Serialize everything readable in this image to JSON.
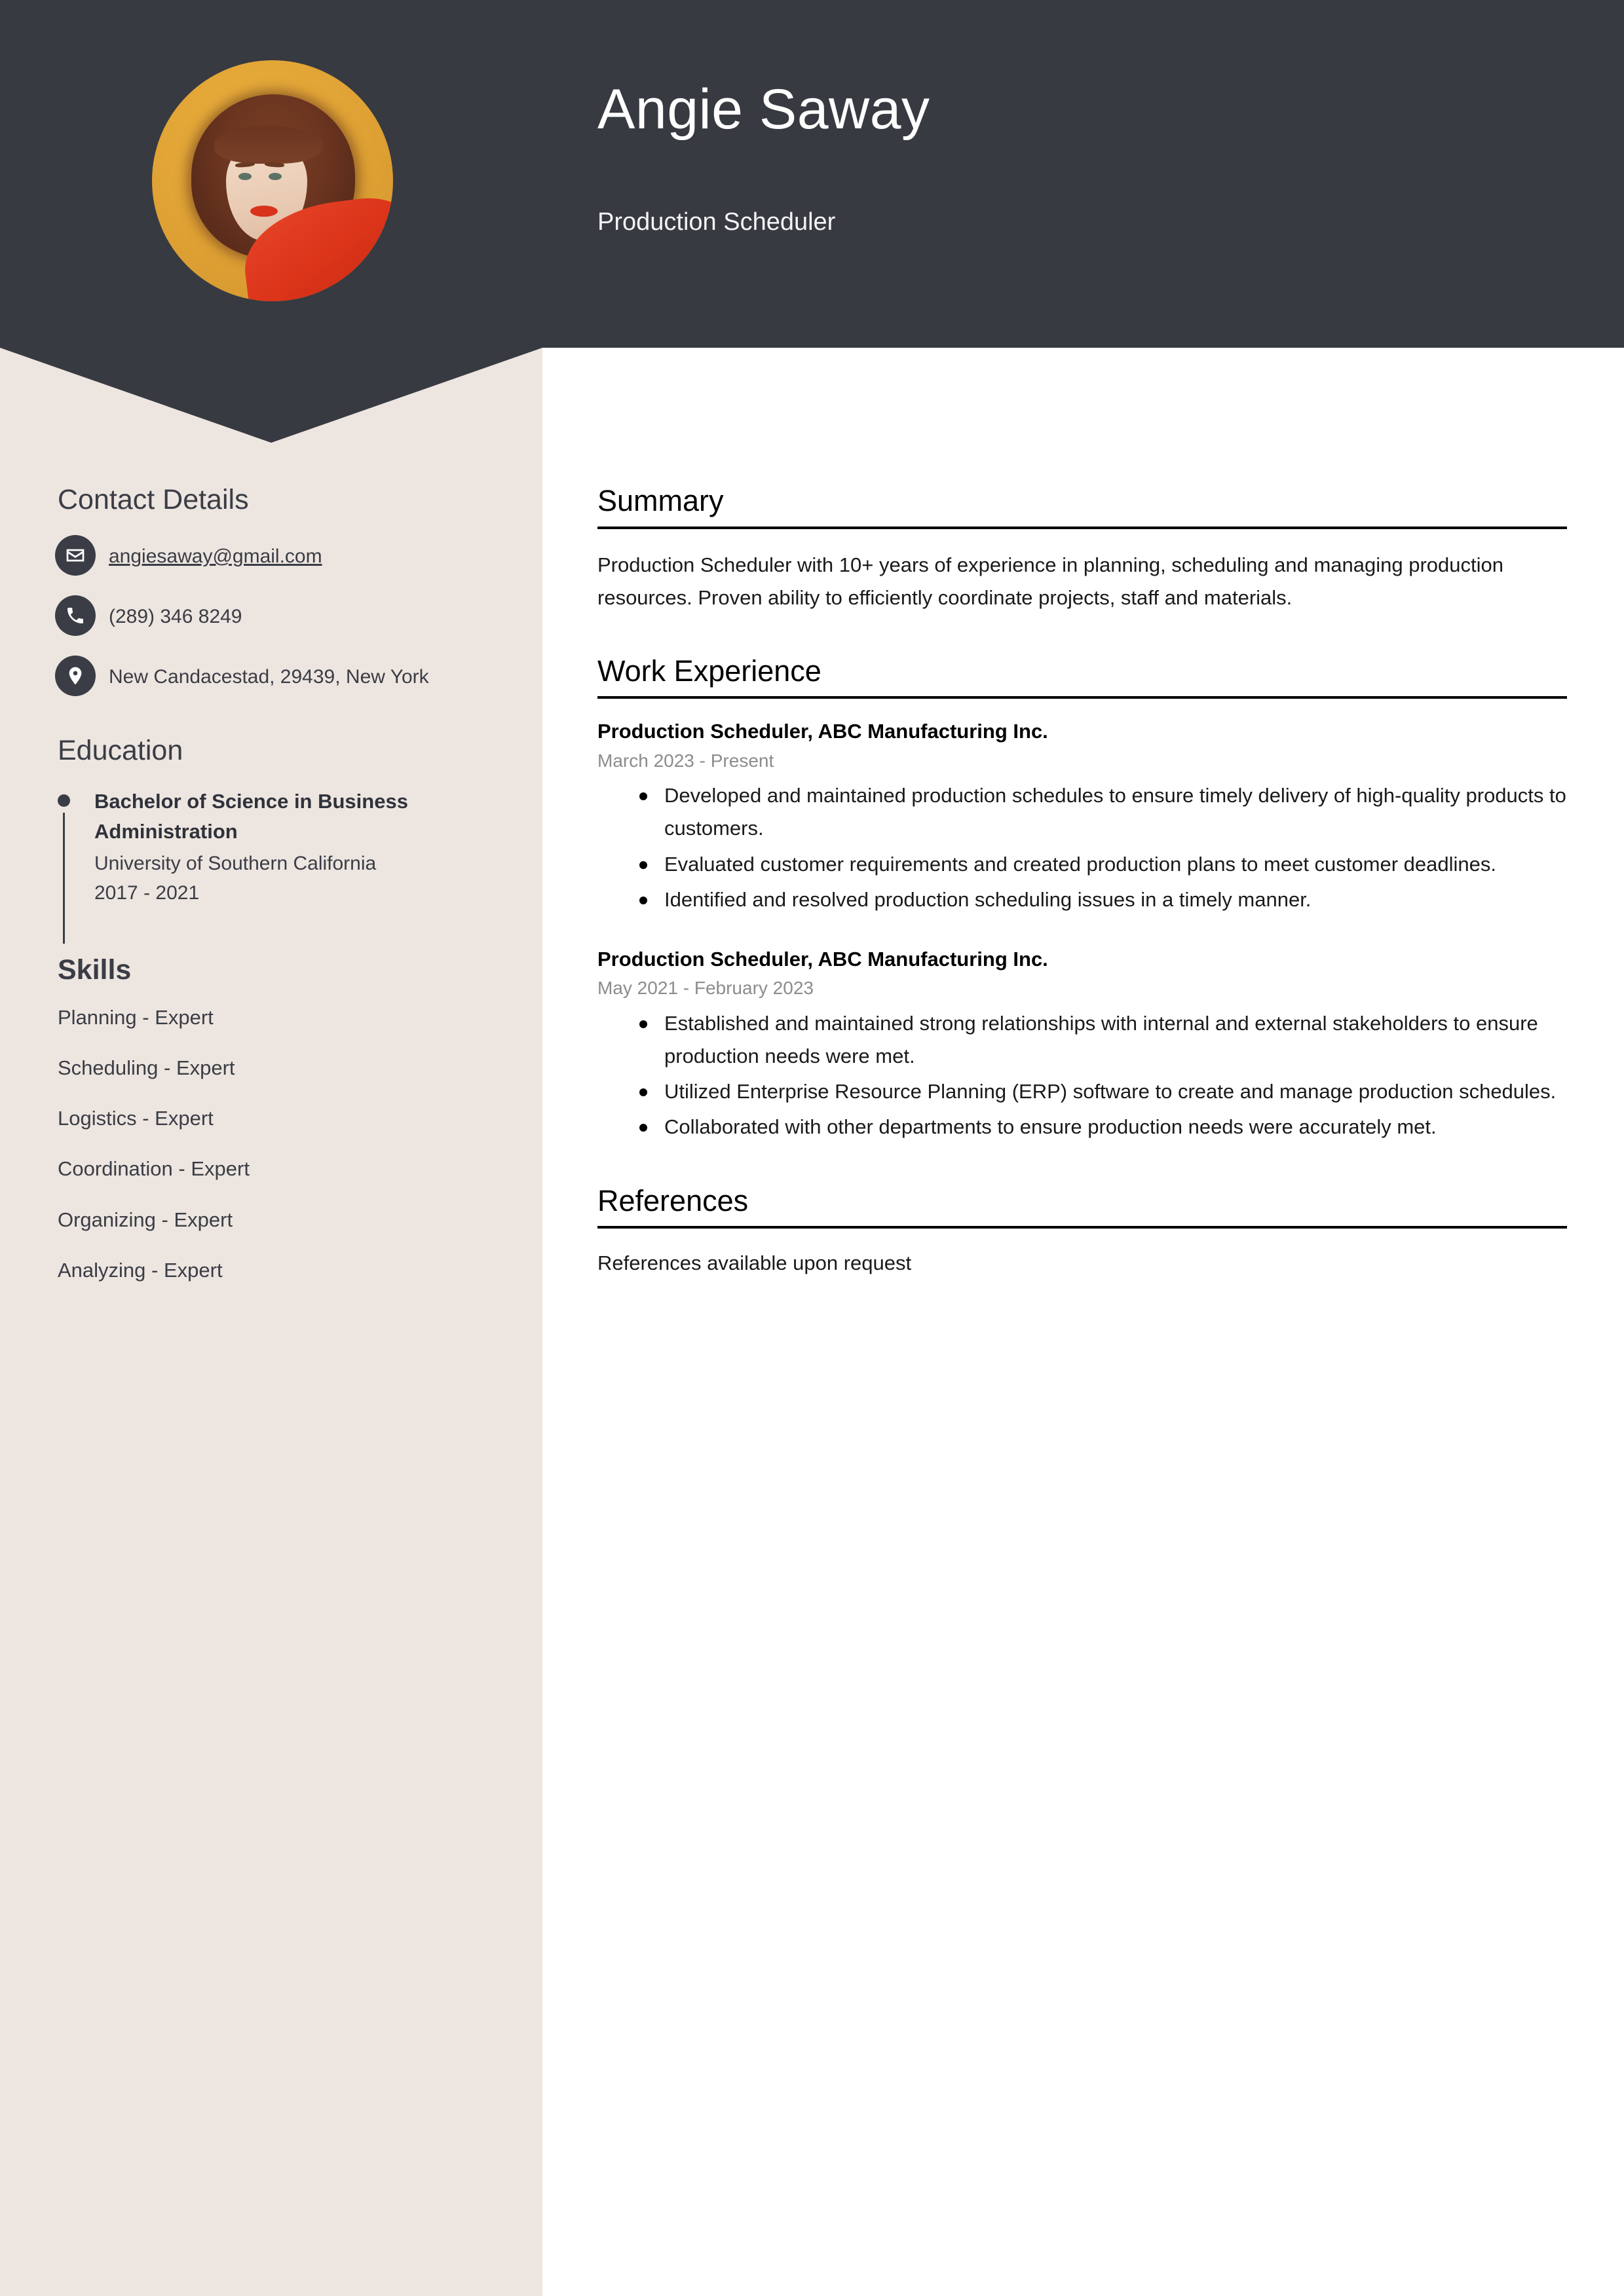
{
  "header": {
    "name": "Angie Saway",
    "job_title": "Production Scheduler",
    "colors": {
      "background": "#373A40",
      "text": "#FFFFFF"
    },
    "avatar_alt": "profile-photo"
  },
  "sidebar": {
    "background_color": "#EDE5E0",
    "contact": {
      "heading": "Contact Details",
      "items": [
        {
          "icon": "envelope-icon",
          "value": "angiesaway@gmail.com",
          "is_link": true
        },
        {
          "icon": "phone-icon",
          "value": "(289) 346 8249",
          "is_link": false
        },
        {
          "icon": "location-pin-icon",
          "value": "New Candacestad, 29439, New York",
          "is_link": false
        }
      ]
    },
    "education": {
      "heading": "Education",
      "items": [
        {
          "degree": "Bachelor of Science in Business Administration",
          "school": "University of Southern California",
          "dates": "2017 - 2021"
        }
      ]
    },
    "skills": {
      "heading": "Skills",
      "items": [
        "Planning - Expert",
        "Scheduling - Expert",
        "Logistics - Expert",
        "Coordination - Expert",
        "Organizing - Expert",
        "Analyzing - Expert"
      ]
    }
  },
  "main": {
    "summary": {
      "heading": "Summary",
      "text": "Production Scheduler with 10+ years of experience in planning, scheduling and managing production resources. Proven ability to efficiently coordinate projects, staff and materials."
    },
    "work_experience": {
      "heading": "Work Experience",
      "jobs": [
        {
          "title": "Production Scheduler, ABC Manufacturing Inc.",
          "dates": "March 2023 - Present",
          "bullets": [
            "Developed and maintained production schedules to ensure timely delivery of high-quality products to customers.",
            "Evaluated customer requirements and created production plans to meet customer deadlines.",
            "Identified and resolved production scheduling issues in a timely manner."
          ]
        },
        {
          "title": "Production Scheduler, ABC Manufacturing Inc.",
          "dates": "May 2021 - February 2023",
          "bullets": [
            "Established and maintained strong relationships with internal and external stakeholders to ensure production needs were met.",
            "Utilized Enterprise Resource Planning (ERP) software to create and manage production schedules.",
            "Collaborated with other departments to ensure production needs were accurately met."
          ]
        }
      ]
    },
    "references": {
      "heading": "References",
      "text": "References available upon request"
    }
  }
}
